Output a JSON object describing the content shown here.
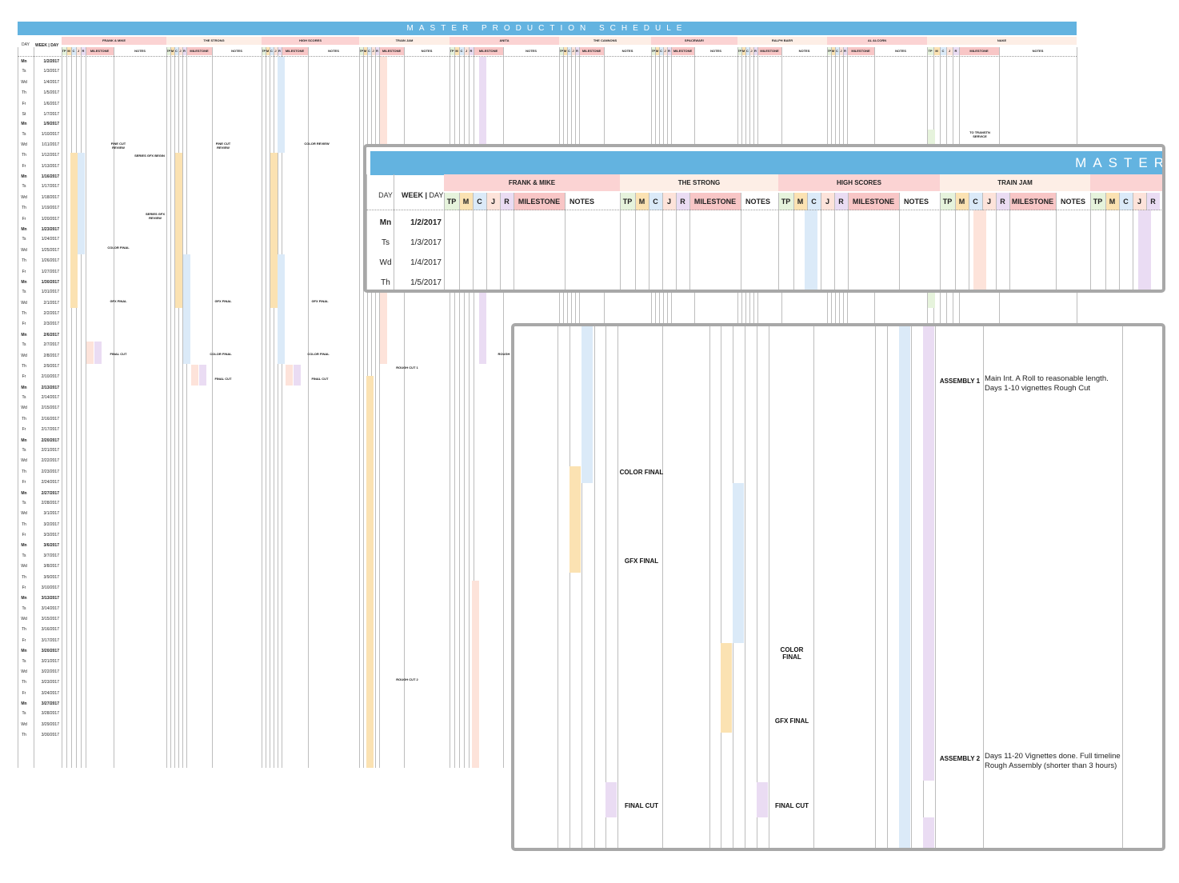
{
  "title": "MASTER PRODUCTION SCHEDULE",
  "zoom_title": "MASTER",
  "header": {
    "day_label": "DAY",
    "week_label": "WEEK",
    "day_sub": "DAY"
  },
  "projects": [
    {
      "name": "FRANK & MIKE"
    },
    {
      "name": "THE STRONG"
    },
    {
      "name": "HIGH SCORES"
    },
    {
      "name": "TRAIN JAM"
    },
    {
      "name": "ANITA"
    },
    {
      "name": "THE CANNONS"
    },
    {
      "name": "SPACEWAR!"
    },
    {
      "name": "RALPH BAER"
    },
    {
      "name": "AL ALCORN"
    },
    {
      "name": "NAKE"
    }
  ],
  "subcolumns": [
    "TP",
    "M",
    "C",
    "J",
    "R",
    "MILESTONE",
    "NOTES"
  ],
  "colors": {
    "header_blue": "#63b3e0",
    "project_pink": "#fbd3d3",
    "project_peach": "#fdeee6",
    "tp_green": "#e6f3dc",
    "m_orange": "#fbe2b2",
    "c_blue": "#dbeaf8",
    "j_peach": "#fde3da",
    "r_purple": "#eadcf3",
    "milestone_pink": "#f8c6c6"
  },
  "rows": [
    {
      "day": "Mn",
      "date": "1/2/2017"
    },
    {
      "day": "Ts",
      "date": "1/3/2017"
    },
    {
      "day": "Wd",
      "date": "1/4/2017"
    },
    {
      "day": "Th",
      "date": "1/5/2017"
    },
    {
      "day": "Fr",
      "date": "1/6/2017"
    },
    {
      "day": "St",
      "date": "1/7/2017"
    },
    {
      "day": "Mn",
      "date": "1/9/2017"
    },
    {
      "day": "Ts",
      "date": "1/10/2017"
    },
    {
      "day": "Wd",
      "date": "1/11/2017"
    },
    {
      "day": "Th",
      "date": "1/12/2017"
    },
    {
      "day": "Fr",
      "date": "1/13/2017"
    },
    {
      "day": "Mn",
      "date": "1/16/2017"
    },
    {
      "day": "Ts",
      "date": "1/17/2017"
    },
    {
      "day": "Wd",
      "date": "1/18/2017"
    },
    {
      "day": "Th",
      "date": "1/19/2017"
    },
    {
      "day": "Fr",
      "date": "1/20/2017"
    },
    {
      "day": "Mn",
      "date": "1/23/2017"
    },
    {
      "day": "Ts",
      "date": "1/24/2017"
    },
    {
      "day": "Wd",
      "date": "1/25/2017"
    },
    {
      "day": "Th",
      "date": "1/26/2017"
    },
    {
      "day": "Fr",
      "date": "1/27/2017"
    },
    {
      "day": "Mn",
      "date": "1/30/2017"
    },
    {
      "day": "Ts",
      "date": "1/31/2017"
    },
    {
      "day": "Wd",
      "date": "2/1/2017"
    },
    {
      "day": "Th",
      "date": "2/2/2017"
    },
    {
      "day": "Fr",
      "date": "2/3/2017"
    },
    {
      "day": "Mn",
      "date": "2/6/2017"
    },
    {
      "day": "Ts",
      "date": "2/7/2017"
    },
    {
      "day": "Wd",
      "date": "2/8/2017"
    },
    {
      "day": "Th",
      "date": "2/9/2017"
    },
    {
      "day": "Fr",
      "date": "2/10/2017"
    },
    {
      "day": "Mn",
      "date": "2/13/2017"
    },
    {
      "day": "Ts",
      "date": "2/14/2017"
    },
    {
      "day": "Wd",
      "date": "2/15/2017"
    },
    {
      "day": "Th",
      "date": "2/16/2017"
    },
    {
      "day": "Fr",
      "date": "2/17/2017"
    },
    {
      "day": "Mn",
      "date": "2/20/2017"
    },
    {
      "day": "Ts",
      "date": "2/21/2017"
    },
    {
      "day": "Wd",
      "date": "2/22/2017"
    },
    {
      "day": "Th",
      "date": "2/23/2017"
    },
    {
      "day": "Fr",
      "date": "2/24/2017"
    },
    {
      "day": "Mn",
      "date": "2/27/2017"
    },
    {
      "day": "Ts",
      "date": "2/28/2017"
    },
    {
      "day": "Wd",
      "date": "3/1/2017"
    },
    {
      "day": "Th",
      "date": "3/2/2017"
    },
    {
      "day": "Fr",
      "date": "3/3/2017"
    },
    {
      "day": "Mn",
      "date": "3/6/2017"
    },
    {
      "day": "Ts",
      "date": "3/7/2017"
    },
    {
      "day": "Wd",
      "date": "3/8/2017"
    },
    {
      "day": "Th",
      "date": "3/9/2017"
    },
    {
      "day": "Fr",
      "date": "3/10/2017"
    },
    {
      "day": "Mn",
      "date": "3/13/2017"
    },
    {
      "day": "Ts",
      "date": "3/14/2017"
    },
    {
      "day": "Wd",
      "date": "3/15/2017"
    },
    {
      "day": "Th",
      "date": "3/16/2017"
    },
    {
      "day": "Fr",
      "date": "3/17/2017"
    },
    {
      "day": "Mn",
      "date": "3/20/2017"
    },
    {
      "day": "Ts",
      "date": "3/21/2017"
    },
    {
      "day": "Wd",
      "date": "3/22/2017"
    },
    {
      "day": "Th",
      "date": "3/23/2017"
    },
    {
      "day": "Fr",
      "date": "3/24/2017"
    },
    {
      "day": "Mn",
      "date": "3/27/2017"
    },
    {
      "day": "Ts",
      "date": "3/28/2017"
    },
    {
      "day": "Wd",
      "date": "3/29/2017"
    },
    {
      "day": "Th",
      "date": "3/30/2017"
    }
  ],
  "milestones": {
    "fine_cut_review": "FINE CUT\nREVIEW",
    "series_gfx_begin": "SERIES GFX BEGIN",
    "series_gfx_review": "SERIES GFX\nREVIEW",
    "color_review": "COLOR REVIEW",
    "color_final": "COLOR FINAL",
    "gfx_final": "GFX FINAL",
    "final_cut": "FINAL CUT",
    "rough_cut_1": "ROUGH CUT 1",
    "rough_cut_2": "ROUGH CUT 2",
    "rough": "ROUGH",
    "to_transtn_service": "TO TRANSTN\nSERVICE"
  },
  "zoom_rows": [
    {
      "day": "Mn",
      "date": "1/2/2017"
    },
    {
      "day": "Ts",
      "date": "1/3/2017"
    },
    {
      "day": "Wd",
      "date": "1/4/2017"
    },
    {
      "day": "Th",
      "date": "1/5/2017"
    }
  ],
  "zoom_projects": [
    "FRANK & MIKE",
    "THE STRONG",
    "HIGH SCORES",
    "TRAIN JAM"
  ],
  "detail": {
    "color_final": "COLOR FINAL",
    "gfx_final": "GFX FINAL",
    "final_cut": "FINAL CUT",
    "assembly_1": "ASSEMBLY 1",
    "assembly_1_note": "Main Int. A Roll to reasonable length. Days 1-10 vignettes Rough Cut",
    "assembly_2": "ASSEMBLY 2",
    "assembly_2_note": "Days 11-20 Vignettes done. Full timeline Rough Assembly (shorter than 3 hours)"
  }
}
